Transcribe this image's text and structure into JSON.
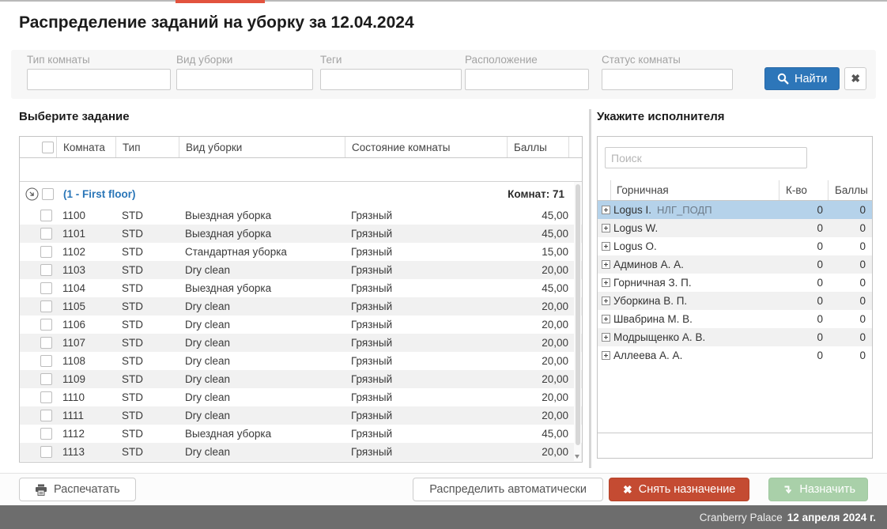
{
  "window": {
    "title": "Распределение заданий на уборку за 12.04.2024"
  },
  "filters": {
    "fields": [
      {
        "label": "Тип комнаты",
        "value": ""
      },
      {
        "label": "Вид уборки",
        "value": ""
      },
      {
        "label": "Теги",
        "value": ""
      },
      {
        "label": "Расположение",
        "value": ""
      },
      {
        "label": "Статус комнаты",
        "value": ""
      }
    ],
    "search_label": "Найти",
    "clear_icon": "✖"
  },
  "tasks": {
    "heading": "Выберите задание",
    "columns": {
      "room": "Комната",
      "type": "Тип",
      "cleaning": "Вид уборки",
      "state": "Состояние комнаты",
      "points": "Баллы"
    },
    "group": {
      "label": "(1 - First floor)",
      "rooms_count": "Комнат: 71"
    },
    "rows": [
      {
        "room": "1100",
        "type": "STD",
        "cleaning": "Выездная уборка",
        "state": "Грязный",
        "points": "45,00"
      },
      {
        "room": "1101",
        "type": "STD",
        "cleaning": "Выездная уборка",
        "state": "Грязный",
        "points": "45,00"
      },
      {
        "room": "1102",
        "type": "STD",
        "cleaning": "Стандартная уборка",
        "state": "Грязный",
        "points": "15,00"
      },
      {
        "room": "1103",
        "type": "STD",
        "cleaning": "Dry clean",
        "state": "Грязный",
        "points": "20,00"
      },
      {
        "room": "1104",
        "type": "STD",
        "cleaning": "Выездная уборка",
        "state": "Грязный",
        "points": "45,00"
      },
      {
        "room": "1105",
        "type": "STD",
        "cleaning": "Dry clean",
        "state": "Грязный",
        "points": "20,00"
      },
      {
        "room": "1106",
        "type": "STD",
        "cleaning": "Dry clean",
        "state": "Грязный",
        "points": "20,00"
      },
      {
        "room": "1107",
        "type": "STD",
        "cleaning": "Dry clean",
        "state": "Грязный",
        "points": "20,00"
      },
      {
        "room": "1108",
        "type": "STD",
        "cleaning": "Dry clean",
        "state": "Грязный",
        "points": "20,00"
      },
      {
        "room": "1109",
        "type": "STD",
        "cleaning": "Dry clean",
        "state": "Грязный",
        "points": "20,00"
      },
      {
        "room": "1110",
        "type": "STD",
        "cleaning": "Dry clean",
        "state": "Грязный",
        "points": "20,00"
      },
      {
        "room": "1111",
        "type": "STD",
        "cleaning": "Dry clean",
        "state": "Грязный",
        "points": "20,00"
      },
      {
        "room": "1112",
        "type": "STD",
        "cleaning": "Выездная уборка",
        "state": "Грязный",
        "points": "45,00"
      },
      {
        "room": "1113",
        "type": "STD",
        "cleaning": "Dry clean",
        "state": "Грязный",
        "points": "20,00"
      }
    ]
  },
  "assignees": {
    "heading": "Укажите исполнителя",
    "search_placeholder": "Поиск",
    "columns": {
      "maid": "Горничная",
      "count": "К-во",
      "points": "Баллы"
    },
    "rows": [
      {
        "name": "Logus I.",
        "tag": "НЛГ_ПОДП",
        "count": "0",
        "points": "0",
        "selected": true
      },
      {
        "name": "Logus W.",
        "tag": "",
        "count": "0",
        "points": "0"
      },
      {
        "name": "Logus O.",
        "tag": "",
        "count": "0",
        "points": "0"
      },
      {
        "name": "Админов А. А.",
        "tag": "",
        "count": "0",
        "points": "0"
      },
      {
        "name": "Горничная З. П.",
        "tag": "",
        "count": "0",
        "points": "0"
      },
      {
        "name": "Уборкина В. П.",
        "tag": "",
        "count": "0",
        "points": "0"
      },
      {
        "name": "Швабрина М. В.",
        "tag": "",
        "count": "0",
        "points": "0"
      },
      {
        "name": "Модрыщенко А. В.",
        "tag": "",
        "count": "0",
        "points": "0"
      },
      {
        "name": "Аллеева А. А.",
        "tag": "",
        "count": "0",
        "points": "0"
      }
    ]
  },
  "actions": {
    "print": "Распечатать",
    "auto_assign": "Распределить автоматически",
    "unassign": "Снять назначение",
    "unassign_icon": "✖",
    "assign": "Назначить"
  },
  "statusbar": {
    "hotel": "Cranberry Palace",
    "date": "12 апреля 2024 г."
  },
  "colors": {
    "accent_blue": "#2d76b9",
    "danger_red": "#c44b32",
    "assign_green": "#a9d0a9",
    "selected_row": "#b5d2ea",
    "top_accent_red": "#e2533e",
    "statusbar_gray": "#6d6d6d"
  }
}
